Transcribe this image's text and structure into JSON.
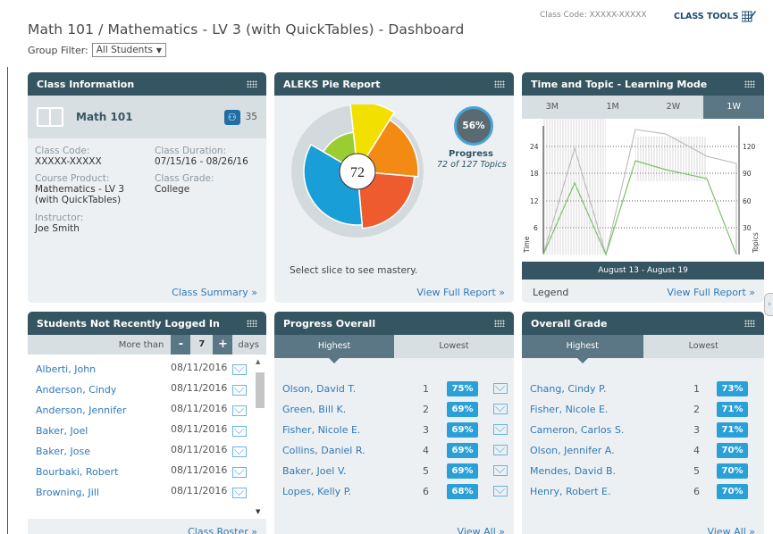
{
  "header": {
    "title": "Math 101 / Mathematics - LV 3 (with QuickTables) - Dashboard",
    "group_filter_label": "Group Filter:",
    "group_filter_value": "All Students",
    "class_code_text": "Class Code: XXXXX-XXXXX",
    "class_tools_label": "CLASS TOOLS"
  },
  "class_info": {
    "title": "Class Information",
    "class_name": "Math 101",
    "student_count": "35",
    "class_code_label": "Class Code:",
    "class_code_value": "XXXXX-XXXXX",
    "duration_label": "Class Duration:",
    "duration_value": "07/15/16 - 08/26/16",
    "product_label": "Course Product:",
    "product_value_line1": "Mathematics - LV 3",
    "product_value_line2": "(with QuickTables)",
    "grade_label": "Class Grade:",
    "grade_value": "College",
    "instructor_label": "Instructor:",
    "instructor_value": "Joe Smith",
    "footer_link": "Class Summary »"
  },
  "pie_report": {
    "title": "ALEKS Pie Report",
    "center_value": "72",
    "progress_percent": "56%",
    "progress_label": "Progress",
    "progress_detail": "72 of 127 Topics",
    "hint": "Select slice to see mastery.",
    "footer_link": "View Full Report »",
    "slices": [
      {
        "color": "#f2e000",
        "start": -6,
        "end": 32,
        "r": 78
      },
      {
        "color": "#f28a14",
        "start": 32,
        "end": 95,
        "r": 68
      },
      {
        "color": "#ee5b2e",
        "start": 95,
        "end": 175,
        "r": 64
      },
      {
        "color": "#1a9ed8",
        "start": 175,
        "end": 300,
        "r": 60
      },
      {
        "color": "#9acd32",
        "start": 300,
        "end": 354,
        "r": 44
      }
    ]
  },
  "time_topic": {
    "title": "Time and Topic - Learning Mode",
    "tabs": [
      "3M",
      "1M",
      "2W",
      "1W"
    ],
    "active_tab": "1W",
    "date_range": "August 13 - August 19",
    "legend_label": "Legend",
    "footer_link": "View Full Report »",
    "left_axis_label": "Time",
    "right_axis_label": "Topics",
    "left_ticks": [
      "24",
      "18",
      "12",
      "6"
    ],
    "right_ticks": [
      "120",
      "90",
      "60",
      "30"
    ]
  },
  "not_logged_in": {
    "title": "Students Not Recently Logged In",
    "more_than_label": "More than",
    "days_value": "7",
    "days_label": "days",
    "footer_link": "Class Roster »",
    "students": [
      {
        "name": "Alberti, John",
        "date": "08/11/2016"
      },
      {
        "name": "Anderson, Cindy",
        "date": "08/11/2016"
      },
      {
        "name": "Anderson, Jennifer",
        "date": "08/11/2016"
      },
      {
        "name": "Baker, Joel",
        "date": "08/11/2016"
      },
      {
        "name": "Baker, Jose",
        "date": "08/11/2016"
      },
      {
        "name": "Bourbaki, Robert",
        "date": "08/11/2016"
      },
      {
        "name": "Browning, Jill",
        "date": "08/11/2016"
      }
    ]
  },
  "progress_overall": {
    "title": "Progress Overall",
    "tab_highest": "Highest",
    "tab_lowest": "Lowest",
    "footer_link": "View All »",
    "rows": [
      {
        "name": "Olson, David T.",
        "rank": "1",
        "value": "75%"
      },
      {
        "name": "Green, Bill K.",
        "rank": "2",
        "value": "69%"
      },
      {
        "name": "Fisher, Nicole E.",
        "rank": "3",
        "value": "69%"
      },
      {
        "name": "Collins, Daniel R.",
        "rank": "4",
        "value": "69%"
      },
      {
        "name": "Baker, Joel V.",
        "rank": "5",
        "value": "69%"
      },
      {
        "name": "Lopes, Kelly P.",
        "rank": "6",
        "value": "68%"
      }
    ]
  },
  "overall_grade": {
    "title": "Overall Grade",
    "tab_highest": "Highest",
    "tab_lowest": "Lowest",
    "footer_link": "View All »",
    "rows": [
      {
        "name": "Chang, Cindy P.",
        "rank": "1",
        "value": "73%"
      },
      {
        "name": "Fisher, Nicole E.",
        "rank": "2",
        "value": "71%"
      },
      {
        "name": "Cameron, Carlos S.",
        "rank": "3",
        "value": "71%"
      },
      {
        "name": "Olson, Jennifer A.",
        "rank": "4",
        "value": "70%"
      },
      {
        "name": "Mendes, David B.",
        "rank": "5",
        "value": "70%"
      },
      {
        "name": "Henry, Robert E.",
        "rank": "6",
        "value": "70%"
      }
    ]
  }
}
